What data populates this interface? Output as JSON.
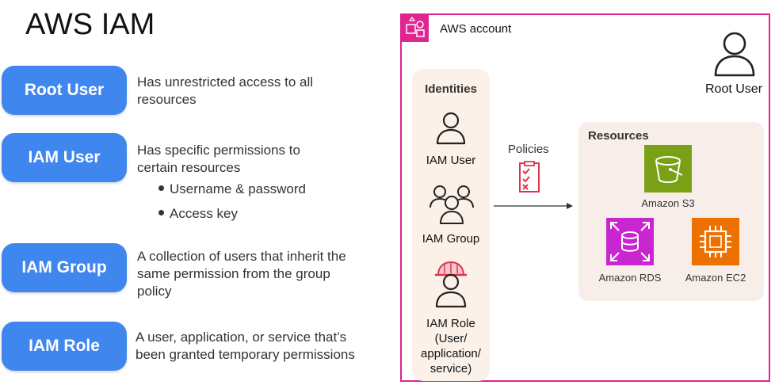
{
  "title": "AWS IAM",
  "left": {
    "items": [
      {
        "label": "Root User",
        "desc": [
          "Has unrestricted access to all",
          "resources"
        ]
      },
      {
        "label": "IAM User",
        "desc": [
          "Has specific permissions to",
          "certain resources"
        ],
        "bullets": [
          "Username & password",
          "Access key"
        ]
      },
      {
        "label": "IAM Group",
        "desc": [
          "A collection of users that inherit the",
          "same permission from the group",
          "policy"
        ]
      },
      {
        "label": "IAM Role",
        "desc": [
          "A user, application, or service that’s",
          "been granted temporary permissions"
        ]
      }
    ]
  },
  "account": {
    "label": "AWS account",
    "root_user": "Root User",
    "policies": "Policies",
    "identities": {
      "title": "Identities",
      "user": "IAM User",
      "group": "IAM Group",
      "role": [
        "IAM Role",
        "(User/",
        "application/",
        "service)"
      ]
    },
    "resources": {
      "title": "Resources",
      "s3": "Amazon S3",
      "rds": "Amazon RDS",
      "ec2": "Amazon EC2"
    }
  },
  "colors": {
    "pill": "#3f86ee",
    "account_border": "#e0258f",
    "s3": "#7aa116",
    "rds": "#c925d1",
    "ec2": "#ed7100",
    "policy_icon": "#dd344c"
  }
}
